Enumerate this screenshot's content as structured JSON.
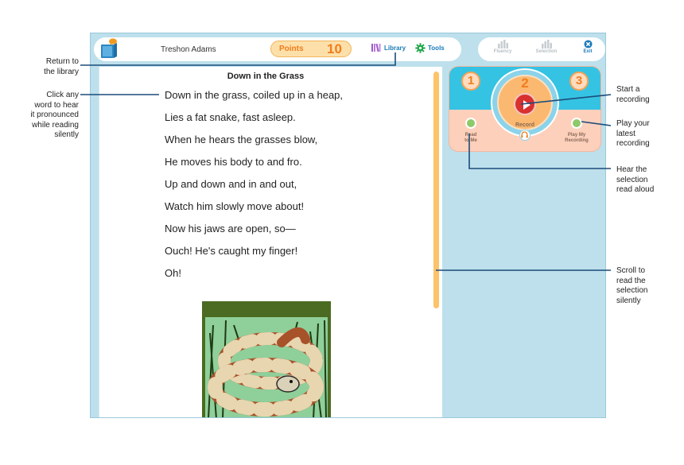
{
  "header": {
    "user_name": "Treshon Adams",
    "points_label": "Points",
    "points_value": "10",
    "library_label": "Library",
    "tools_label": "Tools",
    "fluency_label": "Fluency",
    "selection_label": "Selection",
    "exit_label": "Exit"
  },
  "story": {
    "title": "Down in the Grass",
    "lines": [
      "Down in the grass, coiled up in a heap,",
      "Lies a fat snake, fast asleep.",
      "When he hears the grasses blow,",
      "He moves his body to and fro.",
      "Up and down and in and out,",
      "Watch him slowly move about!",
      "Now his jaws are open, so—",
      "Ouch! He's caught my finger!",
      "Oh!"
    ]
  },
  "recorder": {
    "step_1": "1",
    "step_2": "2",
    "step_3": "3",
    "record_label": "Record",
    "read_to_me_line1": "Read",
    "read_to_me_line2": "to Me",
    "play_recording_line1": "Play My",
    "play_recording_line2": "Recording"
  },
  "annotations": {
    "return_library": [
      "Return to",
      "the library"
    ],
    "click_word": [
      "Click any",
      "word to hear",
      "it pronounced",
      "while reading",
      "silently"
    ],
    "start_recording": [
      "Start a",
      "recording"
    ],
    "play_latest": [
      "Play your",
      "latest",
      "recording"
    ],
    "hear_selection": [
      "Hear the",
      "selection",
      "read aloud"
    ],
    "scroll_read": [
      "Scroll to",
      "read the",
      "selection",
      "silently"
    ]
  },
  "colors": {
    "accent_blue": "#1a7bb9",
    "accent_orange": "#f07d1d",
    "panel_blue": "#bde0ec",
    "scrollbar": "#fcc369",
    "record_red": "#d8312f",
    "annotation_line": "#1d4b7a"
  },
  "icons": {
    "logo": "book-chat-icon",
    "library": "books-icon",
    "tools": "gear-icon",
    "fluency": "bar-chart-icon",
    "selection": "bar-chart-icon",
    "exit": "close-circle-icon",
    "record": "play-icon",
    "headphone": "headphones-icon"
  }
}
